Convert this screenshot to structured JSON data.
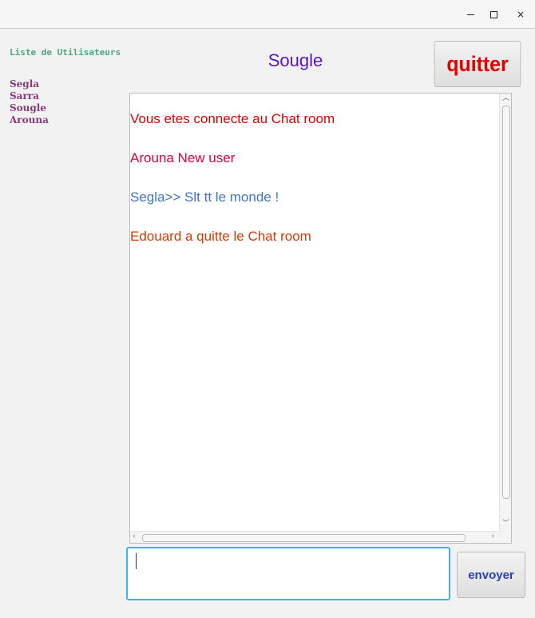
{
  "window": {
    "controls": {
      "minimize_icon": "minimize-icon",
      "maximize_icon": "maximize-icon",
      "close_icon": "close-icon",
      "close_glyph": "×"
    }
  },
  "sidebar": {
    "header": "Liste de Utilisateurs",
    "users": [
      "Segla",
      "Sarra",
      "Sougle",
      "Arouna"
    ]
  },
  "header": {
    "username": "Sougle",
    "quit_label": "quitter"
  },
  "chat": {
    "messages": [
      {
        "text": " Vous etes connecte au Chat room",
        "color": "#e00000"
      },
      {
        "text": "Arouna New user",
        "color": "#e0003a"
      },
      {
        "text": "Segla>> Slt tt le monde !",
        "color": "#3f74c9"
      },
      {
        "text": "Edouard a quitte le Chat room",
        "color": "#d43a00"
      }
    ]
  },
  "composer": {
    "input_value": "",
    "send_label": "envoyer"
  },
  "colors": {
    "users_header": "#4aa87a",
    "user_name": "#8a3a7a",
    "username": "#5a14c8",
    "quit": "#e00000",
    "send": "#2a3dbd",
    "input_focus": "#38b6e8"
  }
}
